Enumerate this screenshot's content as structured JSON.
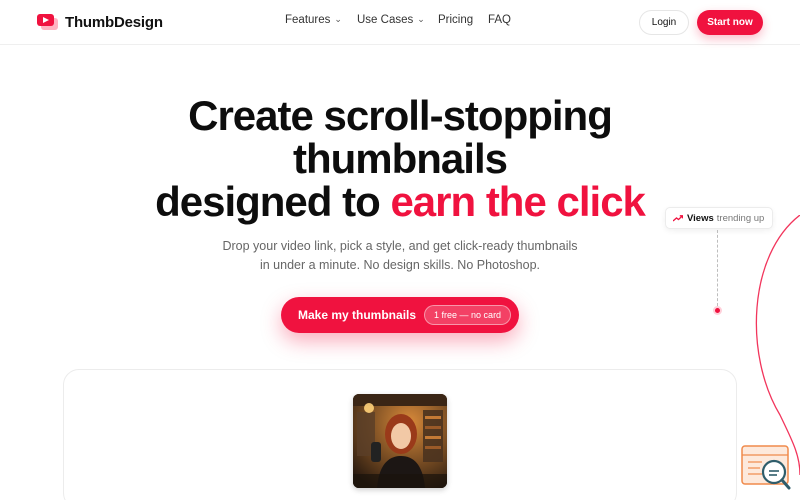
{
  "brand": {
    "name": "ThumbDesign",
    "logo_icon": "youtube-play-logo",
    "accent_color": "#f0123f"
  },
  "nav": {
    "items": [
      {
        "label": "Features",
        "has_dropdown": true
      },
      {
        "label": "Use Cases",
        "has_dropdown": true
      },
      {
        "label": "Pricing",
        "has_dropdown": false
      },
      {
        "label": "FAQ",
        "has_dropdown": false
      }
    ],
    "login_label": "Login",
    "cta_label": "Start now"
  },
  "hero": {
    "title_line1": "Create scroll-stopping",
    "title_line2": "thumbnails",
    "title_line3_prefix": "designed to ",
    "title_line3_accent": "earn the click",
    "subtitle_line1": "Drop your video link, pick a style, and get click-ready thumbnails",
    "subtitle_line2": "in under a minute. No design skills. No Photoshop.",
    "cta_label": "Make my thumbnails",
    "cta_pill": "1 free — no card"
  },
  "trend_badge": {
    "icon": "trending-up-icon",
    "strong": "Views",
    "muted": "trending up"
  },
  "preview": {
    "thumbnail_icon": "creator-thumbnail-image"
  },
  "widget": {
    "icon": "search-chat-widget-icon"
  }
}
